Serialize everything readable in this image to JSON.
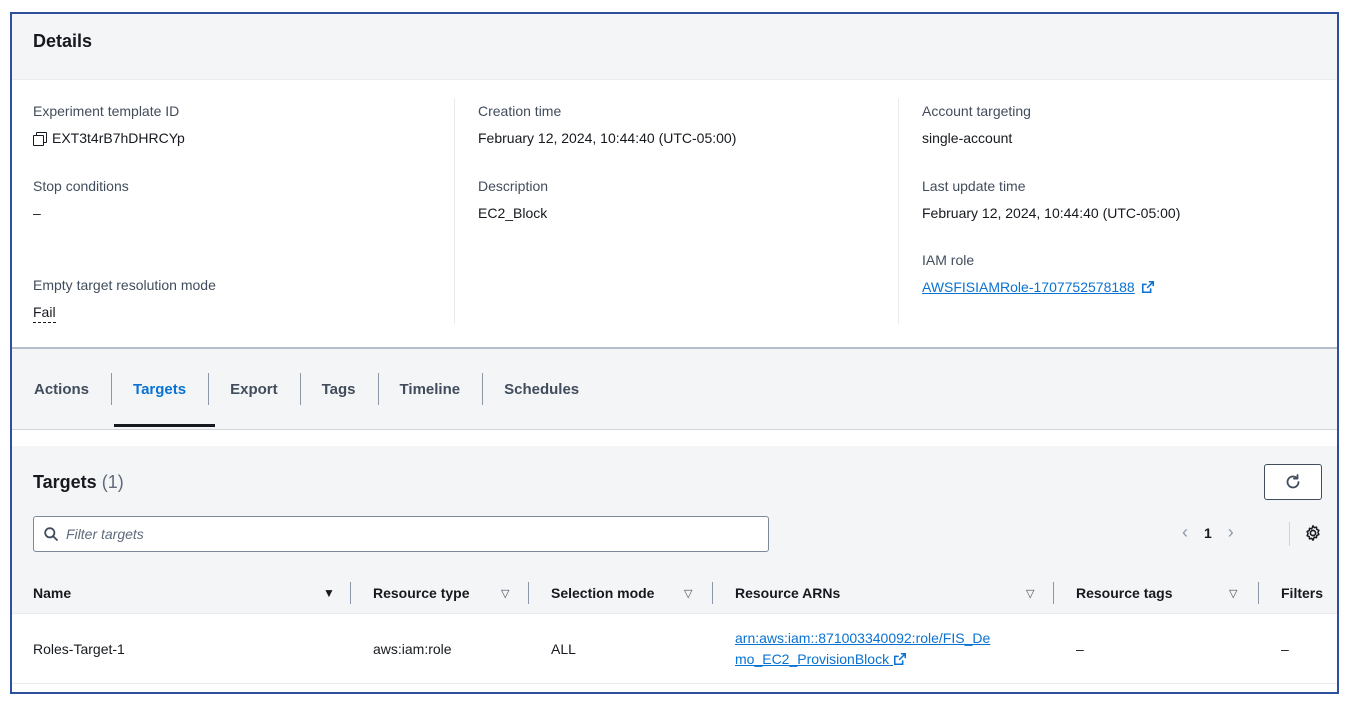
{
  "details": {
    "title": "Details",
    "template_id": {
      "label": "Experiment template ID",
      "value": "EXT3t4rB7hDHRCYp"
    },
    "stop_conditions": {
      "label": "Stop conditions",
      "value": "–"
    },
    "empty_target": {
      "label": "Empty target resolution mode",
      "value": "Fail"
    },
    "creation_time": {
      "label": "Creation time",
      "value": "February 12, 2024, 10:44:40 (UTC-05:00)"
    },
    "description": {
      "label": "Description",
      "value": "EC2_Block"
    },
    "account_targeting": {
      "label": "Account targeting",
      "value": "single-account"
    },
    "last_update": {
      "label": "Last update time",
      "value": "February 12, 2024, 10:44:40 (UTC-05:00)"
    },
    "iam_role": {
      "label": "IAM role",
      "value": "AWSFISIAMRole-1707752578188"
    }
  },
  "tabs": [
    {
      "label": "Actions",
      "active": false
    },
    {
      "label": "Targets",
      "active": true
    },
    {
      "label": "Export",
      "active": false
    },
    {
      "label": "Tags",
      "active": false
    },
    {
      "label": "Timeline",
      "active": false
    },
    {
      "label": "Schedules",
      "active": false
    }
  ],
  "targets": {
    "title": "Targets",
    "count": "(1)",
    "filter_placeholder": "Filter targets",
    "page": "1",
    "columns": [
      "Name",
      "Resource type",
      "Selection mode",
      "Resource ARNs",
      "Resource tags",
      "Filters"
    ],
    "rows": [
      {
        "name": "Roles-Target-1",
        "resource_type": "aws:iam:role",
        "selection_mode": "ALL",
        "arn_line1": "arn:aws:iam::871003340092:role/FIS_De",
        "arn_line2": "mo_EC2_ProvisionBlock",
        "resource_tags": "–",
        "filters": "–"
      }
    ]
  },
  "colors": {
    "accent": "#0972d3",
    "frame_border": "#2c4f9e",
    "panel_bg": "#f4f5f6"
  }
}
